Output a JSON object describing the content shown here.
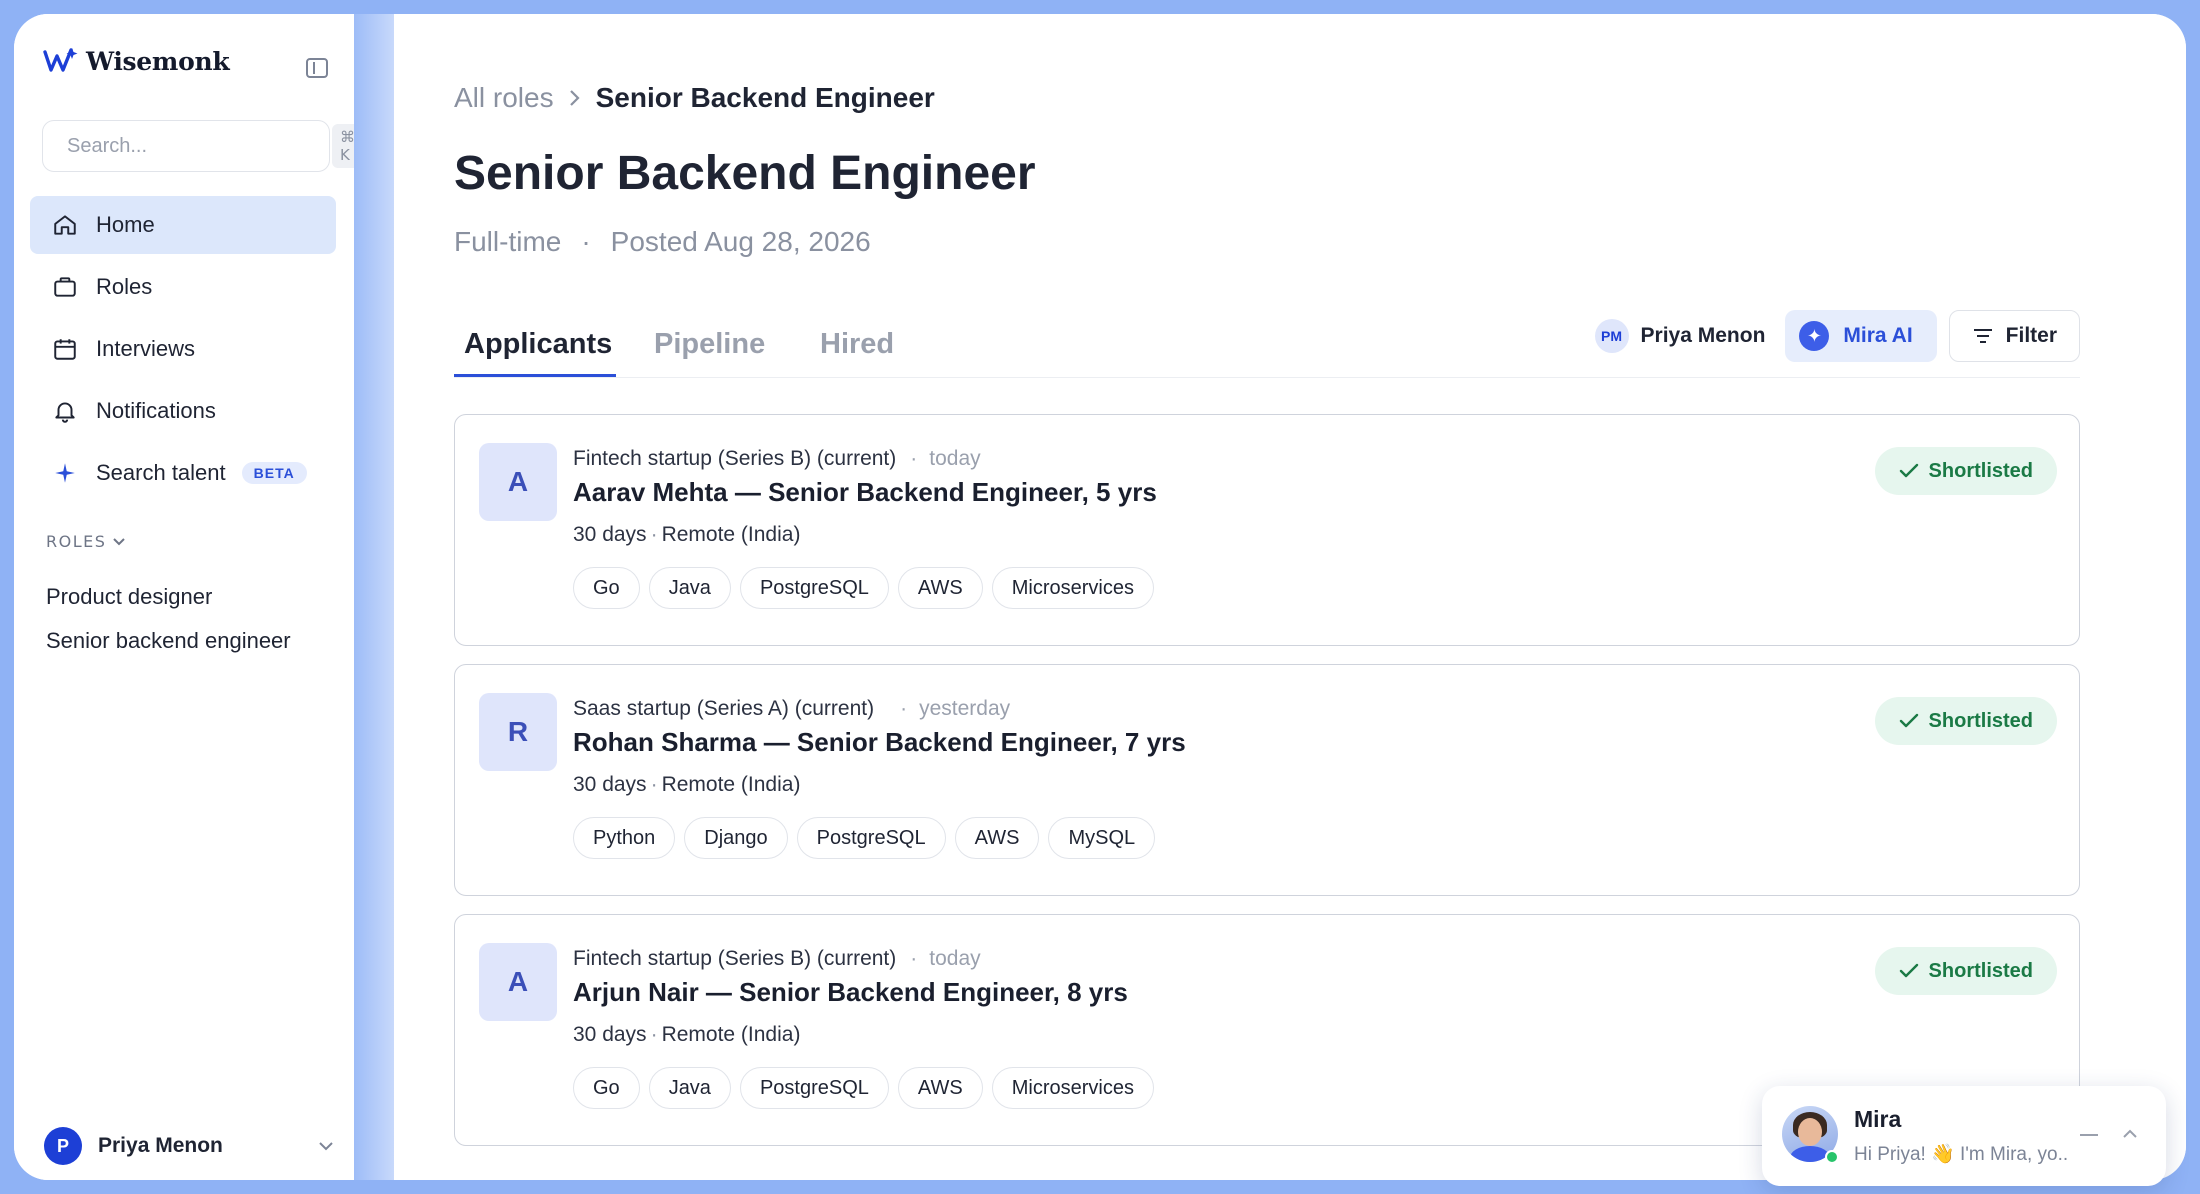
{
  "app": {
    "brand": "Wisemonk",
    "colors": {
      "accent": "#2b4fd8",
      "active_nav": "#dce7fb",
      "success": "#1a7a45",
      "success_bg": "#e6f6ee"
    }
  },
  "sidebar": {
    "search": {
      "placeholder": "Search...",
      "shortcut": "⌘ K"
    },
    "items": [
      {
        "label": "Home",
        "icon": "home-icon",
        "active": true
      },
      {
        "label": "Roles",
        "icon": "briefcase-icon"
      },
      {
        "label": "Interviews",
        "icon": "calendar-icon"
      },
      {
        "label": "Notifications",
        "icon": "bell-icon"
      },
      {
        "label": "Search talent",
        "icon": "sparkle-icon",
        "badge": "BETA"
      }
    ],
    "roles_header": "ROLES",
    "roles": [
      "Product designer",
      "Senior backend engineer"
    ],
    "user": {
      "initial": "P",
      "name": "Priya Menon"
    }
  },
  "main": {
    "breadcrumb": {
      "parent": "All roles",
      "current": "Senior Backend Engineer"
    },
    "title": "Senior Backend Engineer",
    "meta": {
      "type": "Full-time",
      "posted": "Posted Aug 28, 2026"
    },
    "tabs": [
      {
        "label": "Applicants",
        "active": true
      },
      {
        "label": "Pipeline"
      },
      {
        "label": "Hired"
      }
    ],
    "toolbar": {
      "owner_initials": "PM",
      "owner_name": "Priya Menon",
      "ai_label": "Mira AI",
      "filter_label": "Filter"
    },
    "applicants": [
      {
        "initial": "A",
        "company": "Fintech startup (Series B) (current)",
        "time": "today",
        "title": "Aarav Mehta — Senior Backend Engineer, 5 yrs",
        "notice": "30 days",
        "location": "Remote (India)",
        "skills": [
          "Go",
          "Java",
          "PostgreSQL",
          "AWS",
          "Microservices"
        ],
        "status": "Shortlisted"
      },
      {
        "initial": "R",
        "company": "Saas startup (Series A) (current)",
        "time": "yesterday",
        "title": "Rohan Sharma — Senior Backend Engineer, 7 yrs",
        "notice": "30 days",
        "location": "Remote (India)",
        "skills": [
          "Python",
          "Django",
          "PostgreSQL",
          "AWS",
          "MySQL"
        ],
        "status": "Shortlisted"
      },
      {
        "initial": "A",
        "company": "Fintech startup (Series B) (current)",
        "time": "today",
        "title": "Arjun Nair — Senior Backend Engineer, 8 yrs",
        "notice": "30 days",
        "location": "Remote (India)",
        "skills": [
          "Go",
          "Java",
          "PostgreSQL",
          "AWS",
          "Microservices"
        ],
        "status": "Shortlisted"
      }
    ]
  },
  "chat": {
    "name": "Mira",
    "message": "Hi Priya! 👋 I'm Mira, yo.."
  }
}
